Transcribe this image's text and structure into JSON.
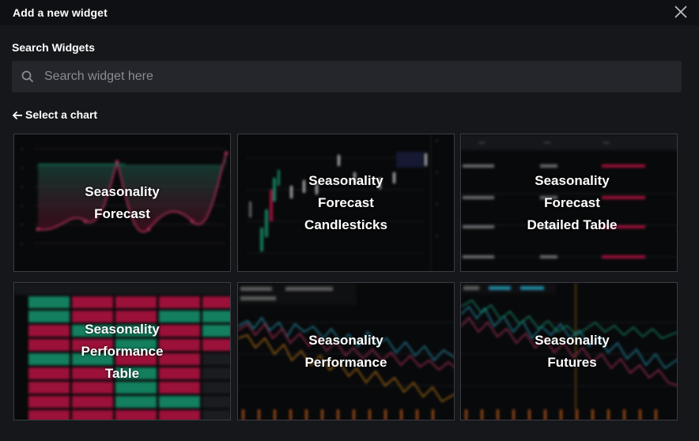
{
  "header": {
    "title": "Add a new widget"
  },
  "search": {
    "label": "Search Widgets",
    "placeholder": "Search widget here"
  },
  "back": {
    "label": "Select a chart"
  },
  "widgets": [
    {
      "label": "Seasonality\nForecast"
    },
    {
      "label": "Seasonality\nForecast\nCandlesticks"
    },
    {
      "label": "Seasonality\nForecast\nDetailed Table"
    },
    {
      "label": "Seasonality\nPerformance\nTable"
    },
    {
      "label": "Seasonality\nPerformance"
    },
    {
      "label": "Seasonality\nFutures"
    }
  ],
  "colors": {
    "green": "#1aa37a",
    "red": "#c8174a",
    "cyan": "#2aa8c8",
    "orange": "#d98a1c",
    "pink": "#c63a6a"
  }
}
